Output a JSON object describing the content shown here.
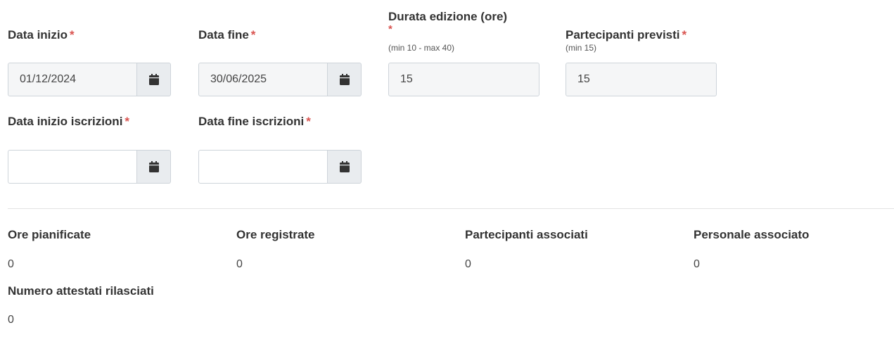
{
  "fields": {
    "data_inizio": {
      "label": "Data inizio",
      "required": "*",
      "value": "01/12/2024"
    },
    "data_fine": {
      "label": "Data fine",
      "required": "*",
      "value": "30/06/2025"
    },
    "durata": {
      "label": "Durata edizione (ore)",
      "required": "*",
      "hint": "(min 10 - max 40)",
      "value": "15"
    },
    "partecipanti": {
      "label": "Partecipanti previsti",
      "required": "*",
      "hint": "(min 15)",
      "value": "15"
    },
    "data_inizio_iscrizioni": {
      "label": "Data inizio iscrizioni",
      "required": "*",
      "value": ""
    },
    "data_fine_iscrizioni": {
      "label": "Data fine iscrizioni",
      "required": "*",
      "value": ""
    }
  },
  "icons": {
    "calendar": "calendar-icon"
  },
  "colors": {
    "required": "#d9534f",
    "addon_bg": "#e9ecef",
    "border": "#ced4da"
  },
  "stats": {
    "ore_pianificate": {
      "label": "Ore pianificate",
      "value": "0"
    },
    "ore_registrate": {
      "label": "Ore registrate",
      "value": "0"
    },
    "partecipanti_associati": {
      "label": "Partecipanti associati",
      "value": "0"
    },
    "personale_associato": {
      "label": "Personale associato",
      "value": "0"
    },
    "attestati": {
      "label": "Numero attestati rilasciati",
      "value": "0"
    }
  }
}
